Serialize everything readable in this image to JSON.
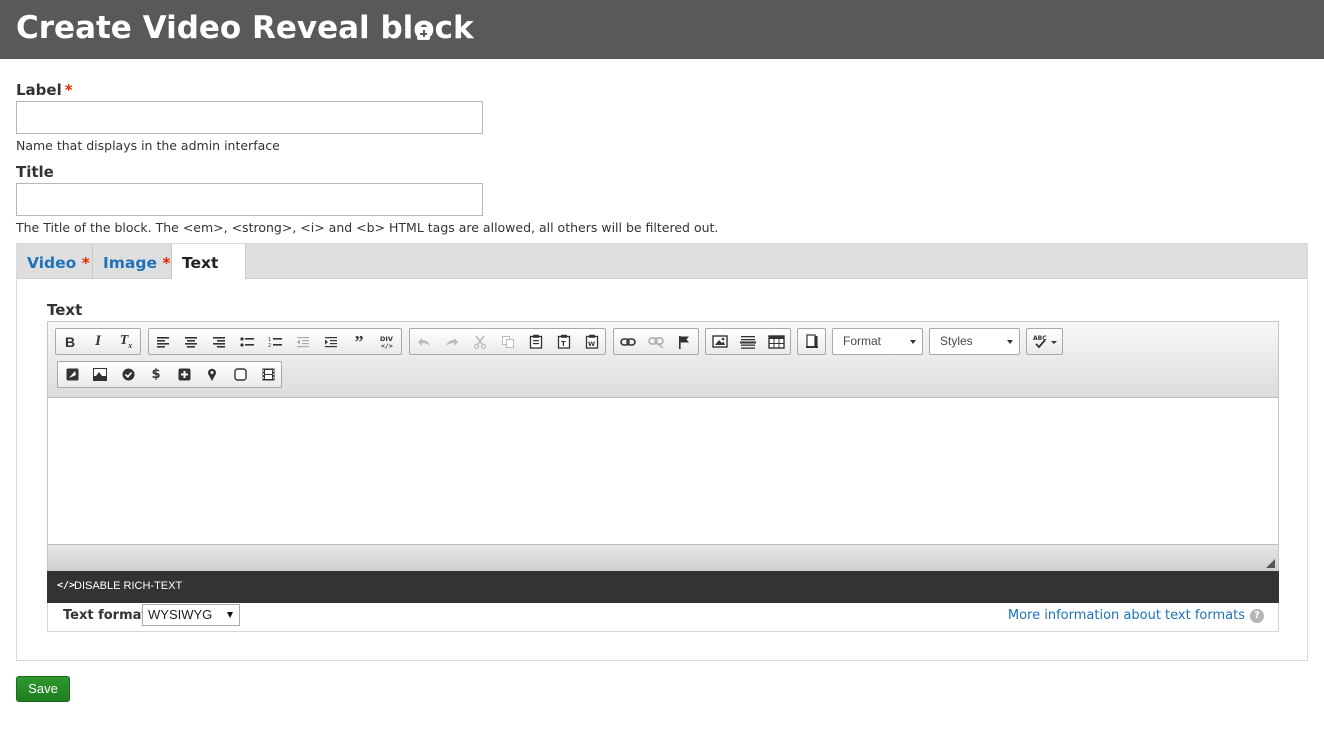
{
  "page": {
    "title": "Create Video Reveal block"
  },
  "label_field": {
    "label": "Label",
    "required_marker": "*",
    "value": "",
    "description": "Name that displays in the admin interface"
  },
  "title_field": {
    "label": "Title",
    "value": "",
    "description": "The Title of the block. The <em>, <strong>, <i> and <b> HTML tags are allowed, all others will be filtered out."
  },
  "tabs": [
    {
      "label": "Video",
      "required_marker": "*",
      "active": false
    },
    {
      "label": "Image",
      "required_marker": "*",
      "active": false
    },
    {
      "label": "Text",
      "required_marker": "",
      "active": true
    }
  ],
  "editor": {
    "field_label": "Text",
    "combos": {
      "format": "Format",
      "styles": "Styles"
    },
    "toolbar_icons": [
      "bold-icon",
      "italic-icon",
      "remove-format-icon",
      "align-left-icon",
      "align-center-icon",
      "align-right-icon",
      "bulleted-list-icon",
      "numbered-list-icon",
      "outdent-icon",
      "indent-icon",
      "blockquote-icon",
      "div-icon",
      "undo-icon",
      "redo-icon",
      "cut-icon",
      "copy-icon",
      "paste-icon",
      "paste-text-icon",
      "paste-word-icon",
      "link-icon",
      "unlink-icon",
      "anchor-icon",
      "image-icon",
      "horizontal-rule-icon",
      "table-icon",
      "source-icon",
      "spellcheck-icon",
      "embed-image-icon",
      "media-icon",
      "check-icon",
      "dollar-icon",
      "plus-box-icon",
      "map-pin-icon",
      "square-icon",
      "film-icon"
    ],
    "disable_rich_text_label": "DISABLE RICH-TEXT",
    "text_format_label": "Text format",
    "text_format_value": "WYSIWYG",
    "more_info_link": "More information about text formats",
    "help_icon_glyph": "?"
  },
  "actions": {
    "save_label": "Save"
  },
  "colors": {
    "header_bg": "#595959",
    "link": "#1e73b8",
    "required": "#e62600",
    "save_button": "#248a24",
    "disable_bar": "#333333"
  }
}
